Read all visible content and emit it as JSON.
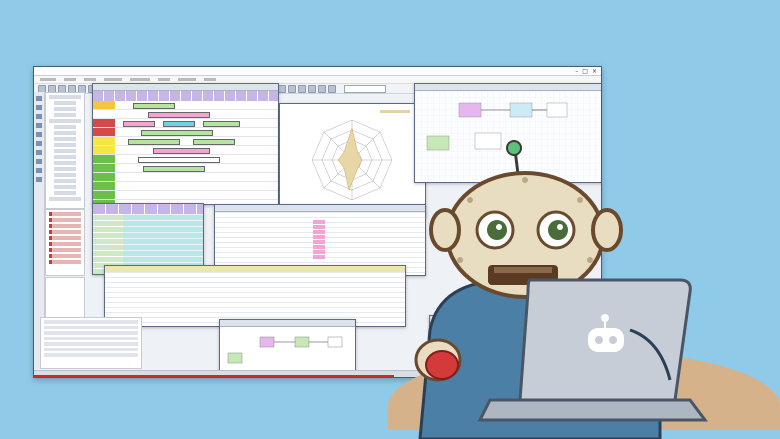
{
  "scene": {
    "background": "#8fcbe9"
  },
  "app": {
    "title": "",
    "menu": [
      "",
      "",
      "",
      "",
      "",
      "",
      "",
      ""
    ],
    "toolbar_buttons": 30
  },
  "colors": {
    "accent": "#d32828",
    "gantt_header": "#c6b6e8",
    "robot_body": "#e9ddc1",
    "robot_suit": "#4b7fa6",
    "laptop": "#c7cdd6"
  }
}
